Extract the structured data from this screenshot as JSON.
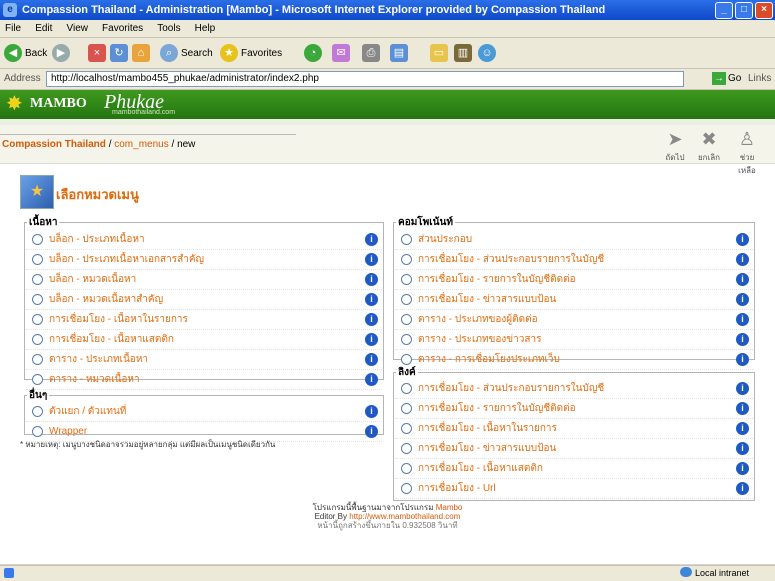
{
  "window": {
    "title": "Compassion Thailand - Administration [Mambo] - Microsoft Internet Explorer provided by Compassion Thailand"
  },
  "menubar": [
    "File",
    "Edit",
    "View",
    "Favorites",
    "Tools",
    "Help"
  ],
  "toolbar": {
    "back": "Back",
    "search": "Search",
    "favorites": "Favorites"
  },
  "addressbar": {
    "label": "Address",
    "url": "http://localhost/mambo455_phukae/administrator/index2.php",
    "go": "Go",
    "links": "Links"
  },
  "header": {
    "brand": "MAMBO",
    "brand_script": "Phukae",
    "subtitle": "mambothailand.com"
  },
  "breadcrumb": {
    "site": "Compassion Thailand",
    "component": "com_menus",
    "action": "new"
  },
  "actions": {
    "next": "ถัดไป",
    "cancel": "ยกเลิก",
    "help": "ช่วยเหลือ"
  },
  "page": {
    "title": "เลือกหมวดเมนู"
  },
  "left": {
    "content_title": "เนื้อหา",
    "content_items": [
      "บล็อก - ประเภทเนื้อหา",
      "บล็อก - ประเภทเนื้อหาเอกสารสำคัญ",
      "บล็อก - หมวดเนื้อหา",
      "บล็อก - หมวดเนื้อหาสำคัญ",
      "การเชื่อมโยง - เนื้อหาในรายการ",
      "การเชื่อมโยง - เนื้อหาแสตติก",
      "ตาราง - ประเภทเนื้อหา",
      "ตาราง - หมวดเนื้อหา"
    ],
    "misc_title": "อื่นๆ",
    "misc_items": [
      "ตัวแยก / ตัวแทนที่",
      "Wrapper"
    ],
    "note": "* หมายเหตุ: เมนูบางชนิดอาจรวมอยู่หลายกลุ่ม แต่มีผลเป็นเมนูชนิดเดียวกัน"
  },
  "right": {
    "components_title": "คอมโพเน้นท์",
    "component_items": [
      "ส่วนประกอบ",
      "การเชื่อมโยง - ส่วนประกอบรายการในบัญชี",
      "การเชื่อมโยง - รายการในบัญชีติดต่อ",
      "การเชื่อมโยง - ข่าวสารแบบป้อน",
      "ตาราง - ประเภทของผู้ติดต่อ",
      "ตาราง - ประเภทของข่าวสาร",
      "ตาราง - การเชื่อมโยงประเภทเว็บ"
    ],
    "links_title": "ลิงค์",
    "link_items": [
      "การเชื่อมโยง - ส่วนประกอบรายการในบัญชี",
      "การเชื่อมโยง - รายการในบัญชีติดต่อ",
      "การเชื่อมโยง - เนื้อหาในรายการ",
      "การเชื่อมโยง - ข่าวสารแบบป้อน",
      "การเชื่อมโยง - เนื้อหาแสตติก",
      "การเชื่อมโยง - Url"
    ]
  },
  "footer": {
    "line1_text": "โปรแกรมนี้พื้นฐานมาจากโปรแกรม ",
    "line1_link": "Mambo",
    "line2_text": "Editor By ",
    "line2_link": "http://www.mambothailand.com",
    "line3": "หน้านี้ถูกสร้างขึ้นภายใน 0.932508 วินาที"
  },
  "status": {
    "zone": "Local intranet"
  },
  "colors": {
    "accent": "#e46c10",
    "header_green": "#2f8a17",
    "info_blue": "#1f59c2"
  }
}
